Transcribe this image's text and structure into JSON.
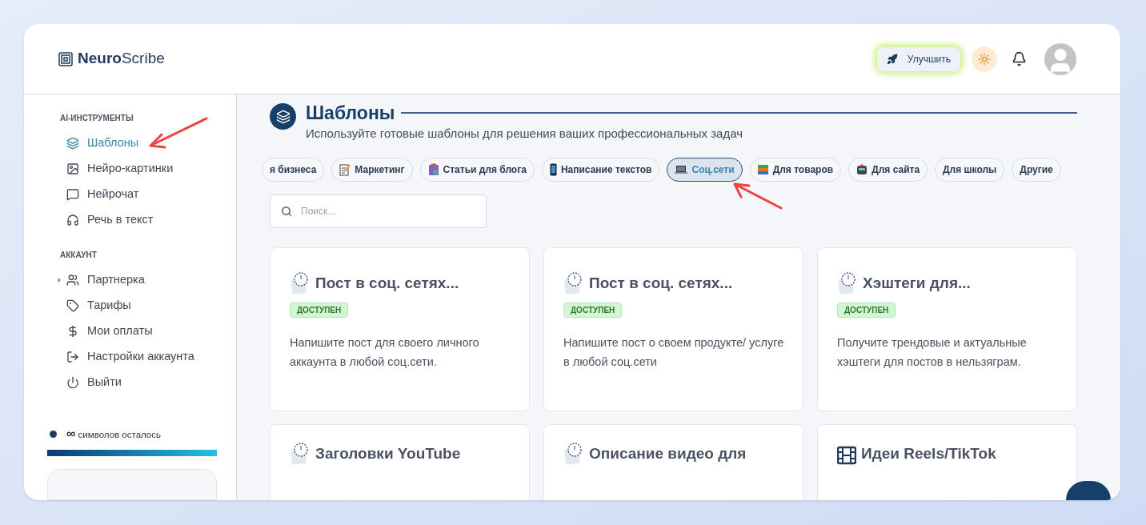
{
  "brand": {
    "bold": "Neuro",
    "rest": "Scribe"
  },
  "header": {
    "upgrade": "Улучшить"
  },
  "sidebar": {
    "sections": [
      {
        "title": "AI-ИНСТРУМЕНТЫ",
        "items": [
          {
            "label": "Шаблоны",
            "kind": "layers",
            "selected": true
          },
          {
            "label": "Нейро-картинки",
            "kind": "image",
            "selected": false
          },
          {
            "label": "Нейрочат",
            "kind": "chat",
            "selected": false
          },
          {
            "label": "Речь в текст",
            "kind": "headphones",
            "selected": false
          }
        ]
      },
      {
        "title": "АККАУНТ",
        "items": [
          {
            "label": "Партнерка",
            "kind": "users",
            "selected": false,
            "expanded": false
          },
          {
            "label": "Тарифы",
            "kind": "tag",
            "selected": false
          },
          {
            "label": "Мои оплаты",
            "kind": "dollar",
            "selected": false
          },
          {
            "label": "Настройки аккаунта",
            "kind": "logout",
            "selected": false
          },
          {
            "label": "Выйти",
            "kind": "power",
            "selected": false
          }
        ]
      }
    ],
    "quota": {
      "amount": "∞",
      "label": "символов осталось",
      "level": 1
    }
  },
  "page": {
    "title": "Шаблоны",
    "subtitle": "Используйте готовые шаблоны для решения ваших профессиональных задач"
  },
  "categories": [
    {
      "label": "я бизнеса",
      "selected": false
    },
    {
      "label": "Маркетинг",
      "kind": "memo",
      "selected": false
    },
    {
      "label": "Статьи для блога",
      "kind": "clipboard",
      "selected": false
    },
    {
      "label": "Написание текстов",
      "kind": "phone",
      "selected": false
    },
    {
      "label": "Соц.сети",
      "kind": "laptop",
      "selected": true
    },
    {
      "label": "Для товаров",
      "kind": "books",
      "selected": false
    },
    {
      "label": "Для сайта",
      "kind": "robot",
      "selected": false
    },
    {
      "label": "Для школы",
      "selected": false
    },
    {
      "label": "Другие",
      "selected": false
    }
  ],
  "search": {
    "placeholder": "Поиск..."
  },
  "templates": [
    {
      "title": "Пост в соц. сетях...",
      "badge": "ДОСТУПЕН",
      "description": "Напишите пост для своего личного аккаунта в любой соц.сети.",
      "kind": "clock"
    },
    {
      "title": "Пост в соц. сетях...",
      "badge": "ДОСТУПЕН",
      "description": "Напишите пост о своем продукте/ услуге в любой соц.сети",
      "kind": "clock"
    },
    {
      "title": "Хэштеги для...",
      "badge": "ДОСТУПЕН",
      "description": "Получите трендовые и актуальные хэштеги для постов в нельзяграм.",
      "kind": "clock"
    },
    {
      "title": "Заголовки YouTube",
      "kind": "clock"
    },
    {
      "title": "Описание видео для",
      "kind": "clock"
    },
    {
      "title": "Идеи Reels/TikTok",
      "kind": "film"
    }
  ]
}
